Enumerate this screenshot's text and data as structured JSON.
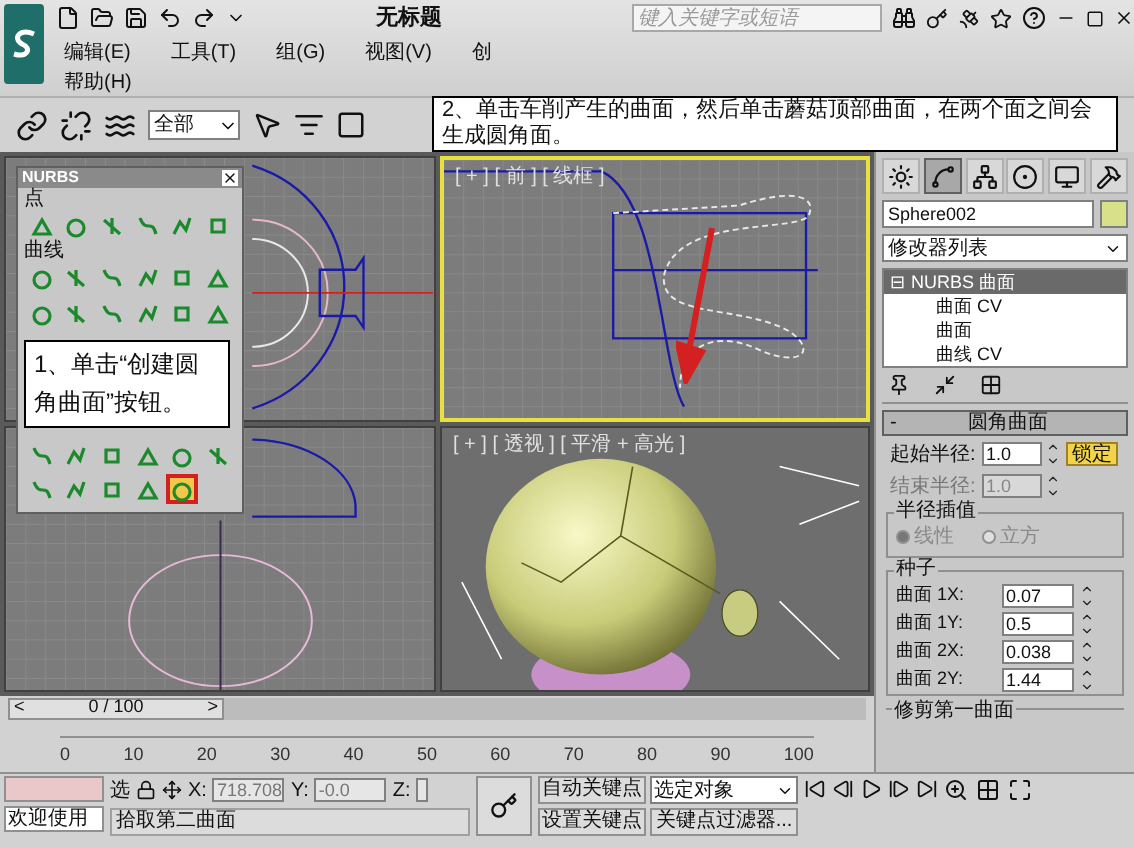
{
  "title_bar": {
    "title": "无标题",
    "search": {
      "placeholder": "键入关键字或短语"
    }
  },
  "menu": [
    {
      "label": "编辑(E)"
    },
    {
      "label": "工具(T)"
    },
    {
      "label": "组(G)"
    },
    {
      "label": "视图(V)"
    },
    {
      "label": "创"
    }
  ],
  "menu_row_2": [
    {
      "label": "帮助(H)"
    }
  ],
  "toolbar": {
    "selection_filter": "全部"
  },
  "nurbs_panel": {
    "title": "NURBS",
    "sections": [
      {
        "label": "点",
        "tools": [
          {
            "selected": false
          },
          {
            "selected": false
          },
          {
            "selected": false
          },
          {
            "selected": false
          },
          {
            "selected": false
          },
          {
            "selected": false
          }
        ]
      },
      {
        "label": "曲线",
        "tools": [
          {
            "selected": false
          },
          {
            "selected": false
          },
          {
            "selected": false
          },
          {
            "selected": false
          },
          {
            "selected": false
          },
          {
            "selected": false
          },
          {
            "selected": false
          },
          {
            "selected": false
          },
          {
            "selected": false
          },
          {
            "selected": false
          },
          {
            "selected": false
          },
          {
            "selected": false
          }
        ]
      }
    ],
    "surface_tools": [
      {
        "selected": false
      },
      {
        "selected": false
      },
      {
        "selected": false
      },
      {
        "selected": false
      },
      {
        "selected": false
      },
      {
        "selected": false
      },
      {
        "selected": false
      },
      {
        "selected": false
      },
      {
        "selected": false
      },
      {
        "selected": false
      },
      {
        "selected": true
      }
    ]
  },
  "callouts": [
    {
      "text": "2、单击车削产生的曲面，然后单击蘑菇顶部曲面，在两个面之间会生成圆角面。"
    },
    {
      "text": "1、单击“创建圆角曲面”按钮。"
    }
  ],
  "viewports": [
    {
      "kind": "top",
      "active": false
    },
    {
      "kind": "front",
      "label": "[ + ] [ 前 ] [ 线框 ]",
      "active": true
    },
    {
      "kind": "left",
      "active": false
    },
    {
      "kind": "perspective",
      "label": "[ + ] [ 透视 ] [ 平滑 + 高光 ]",
      "active": false
    }
  ],
  "command_panel": {
    "tabs": [
      {
        "selected": false
      },
      {
        "selected": true
      },
      {
        "selected": false
      },
      {
        "selected": false
      },
      {
        "selected": false
      },
      {
        "selected": false
      }
    ],
    "object_name": "Sphere002",
    "modifier_list": "修改器列表",
    "stack": [
      {
        "expander": "⊟",
        "label": "NURBS 曲面",
        "selected": true,
        "children": [
          {
            "label": "曲面 CV",
            "selected": false
          },
          {
            "label": "曲面",
            "selected": false
          },
          {
            "label": "曲线 CV",
            "selected": false
          }
        ]
      }
    ],
    "rollout": {
      "title": "圆角曲面",
      "toggle": "-",
      "start_radius": {
        "label": "起始半径:",
        "value": "1.0",
        "disabled": false
      },
      "end_radius": {
        "label": "结束半径:",
        "value": "1.0",
        "disabled": true
      },
      "lock": {
        "label": "锁定",
        "on": true
      },
      "interpolation": {
        "title": "半径插值",
        "disabled": true,
        "options": [
          {
            "label": "线性",
            "selected": true
          },
          {
            "label": "立方",
            "selected": false
          }
        ]
      },
      "seeds": {
        "title": "种子",
        "fields": [
          {
            "label": "曲面 1X:",
            "value": "0.07"
          },
          {
            "label": "曲面 1Y:",
            "value": "0.5"
          },
          {
            "label": "曲面 2X:",
            "value": "0.038"
          },
          {
            "label": "曲面 2Y:",
            "value": "1.44"
          }
        ]
      },
      "trim": {
        "title": "修剪第一曲面"
      }
    }
  },
  "time_slider": {
    "level": 0,
    "prev": "<",
    "text": "0 / 100",
    "next": ">"
  },
  "timeline": {
    "ticks": [
      "0",
      "10",
      "20",
      "30",
      "40",
      "50",
      "60",
      "70",
      "80",
      "90",
      "100"
    ]
  },
  "status_bar": {
    "welcome": "欢迎使用",
    "select_label": "选",
    "x": {
      "label": "X:",
      "value": "718.708"
    },
    "y": {
      "label": "Y:",
      "value": "-0.0"
    },
    "z": {
      "label": "Z:"
    },
    "prompt": "拾取第二曲面",
    "auto_key": "自动关键点",
    "set_key": "设置关键点",
    "key_mode": "选定对象",
    "key_filters": "关键点过滤器..."
  }
}
